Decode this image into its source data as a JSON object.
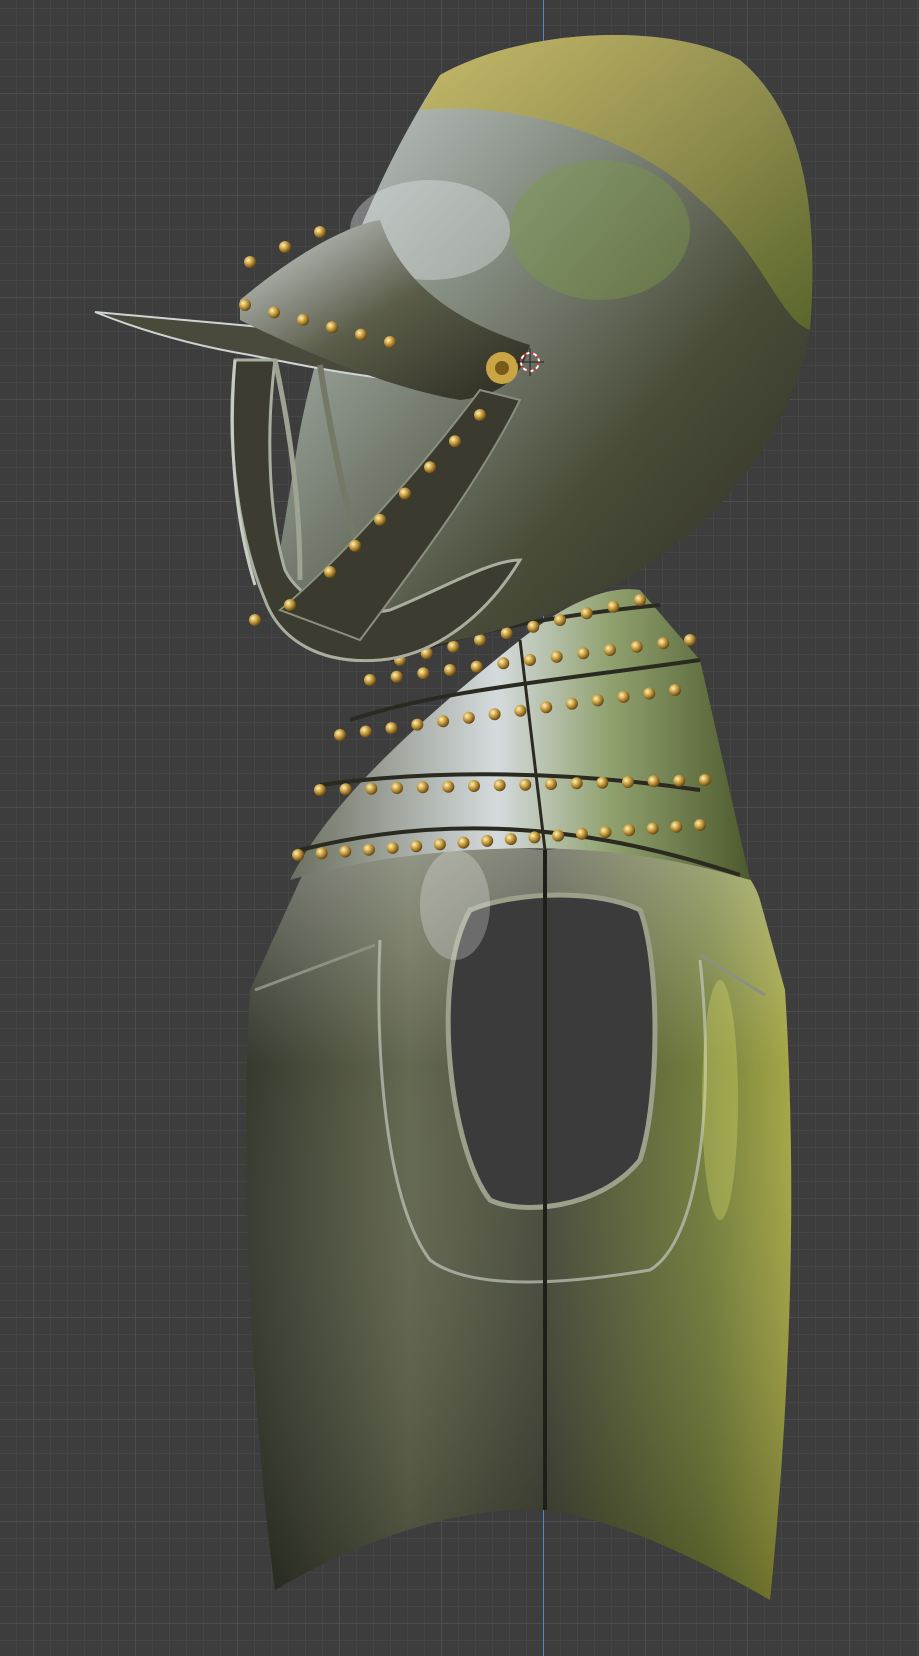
{
  "viewport": {
    "mode": "3d-viewport-orthographic-side",
    "background_color": "#3d3d3d",
    "grid_color": "#4d4d4d",
    "axis_color": "#4f8fd6"
  },
  "model": {
    "object": "armor-helmet-gorget-breastplate",
    "steel_dark": "#2a2d1f",
    "steel_light": "#b8c2c8",
    "gold_tint": "#b59b3a",
    "rivet_color": "#c49a3c"
  },
  "cursor": {
    "icon": "3d-cursor-icon",
    "color": "#d03a3a"
  }
}
